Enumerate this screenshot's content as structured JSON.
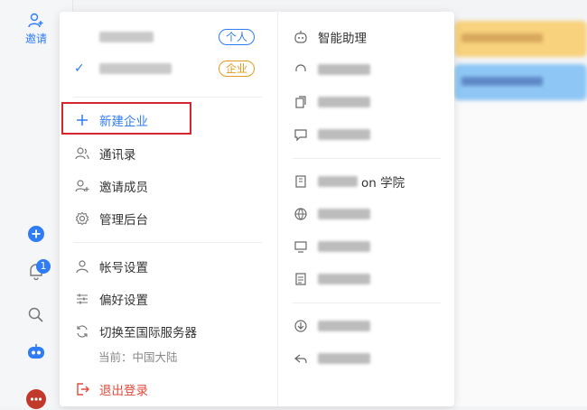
{
  "rail": {
    "invite_label": "邀请",
    "notification_count": "1"
  },
  "menu": {
    "orgs": [
      {
        "tag": "个人",
        "selected": false
      },
      {
        "tag": "企业",
        "selected": true
      }
    ],
    "new_org": "新建企业",
    "contacts": "通讯录",
    "invite_members": "邀请成员",
    "admin": "管理后台",
    "account_settings": "帐号设置",
    "preferences": "偏好设置",
    "switch_server": "切换至国际服务器",
    "current_region": "当前：中国大陆",
    "logout": "退出登录"
  },
  "apps": {
    "assistant": "智能助理",
    "academy_prefix": "on 学院"
  },
  "colors": {
    "accent": "#2f7cf6",
    "danger": "#e24a3b",
    "company_tag": "#e29b1d",
    "highlight_box": "#d6262d"
  }
}
